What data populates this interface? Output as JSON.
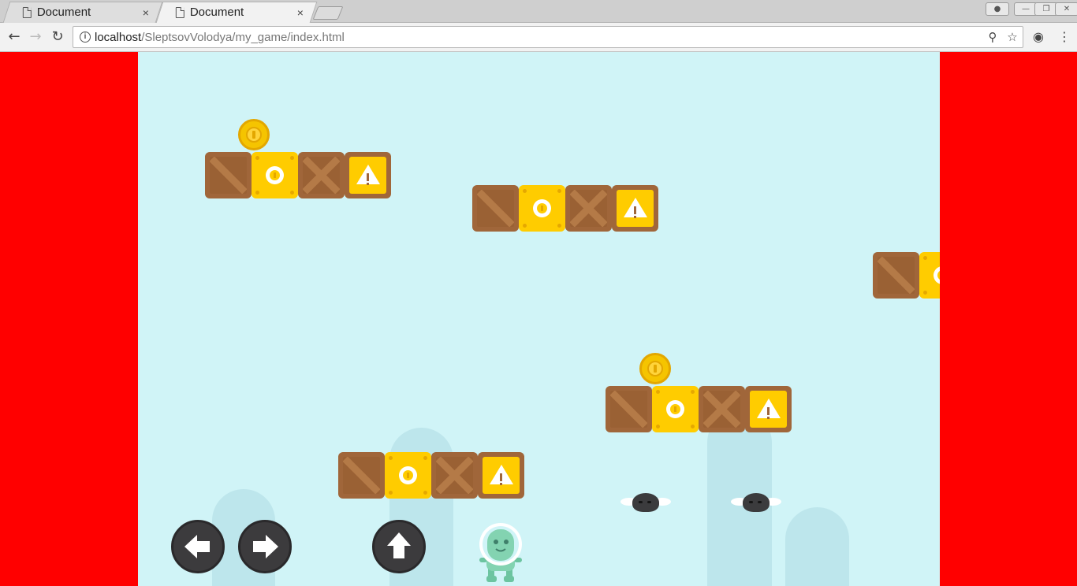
{
  "browser": {
    "tabs": [
      {
        "title": "Document",
        "active": false,
        "close_label": "×"
      },
      {
        "title": "Document",
        "active": true,
        "close_label": "×"
      }
    ],
    "url_host": "localhost",
    "url_path": "/SleptsovVolodya/my_game/index.html",
    "nav_icons": [
      "back-arrow-icon",
      "forward-arrow-icon",
      "reload-icon"
    ],
    "omnibox_icons": [
      "info-icon",
      "zoom-icon",
      "star-icon"
    ],
    "toolbar_icons": [
      "extension-icon",
      "menu-icon"
    ],
    "window_controls": [
      "profile-icon",
      "minimize-icon",
      "restore-icon",
      "close-icon"
    ]
  },
  "page": {
    "background_color": "#ff0000",
    "game_background_color": "#d0f4f7"
  },
  "game": {
    "platforms": [
      {
        "blocks": [
          "crate",
          "coin-box",
          "crate",
          "warning"
        ],
        "coin_above": true
      },
      {
        "blocks": [
          "crate",
          "coin-box",
          "crate",
          "warning"
        ],
        "coin_above": false
      },
      {
        "blocks": [
          "crate",
          "coin-box"
        ],
        "coin_above": false
      },
      {
        "blocks": [
          "crate",
          "coin-box",
          "crate",
          "warning"
        ],
        "coin_above": true
      },
      {
        "blocks": [
          "crate",
          "coin-box",
          "crate",
          "warning"
        ],
        "coin_above": false
      }
    ],
    "enemies": [
      "fly-enemy",
      "fly-enemy"
    ],
    "player": "alien-player",
    "controls": [
      "left-arrow-button",
      "right-arrow-button",
      "jump-button"
    ]
  }
}
